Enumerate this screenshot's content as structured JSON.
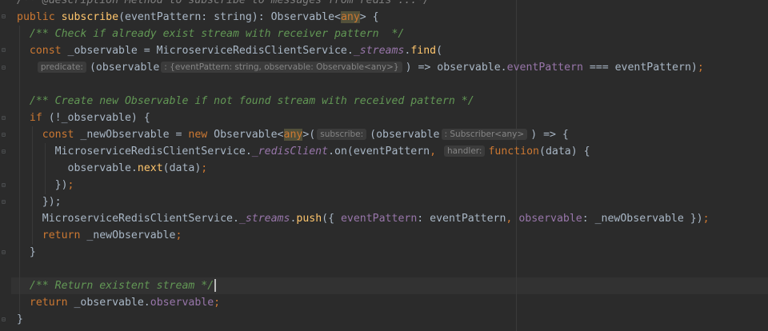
{
  "editor": {
    "lines": {
      "l0": "/** @description Method to subscribe to messages from redis ...*/",
      "l1_kw": "public",
      "l1_fn": "subscribe",
      "l1_a": "(eventPattern: string): Observable<",
      "l1_any": "any",
      "l1_b": "> {",
      "l2": "/** Check if already exist stream with receiver pattern  */",
      "l3_kw": "const",
      "l3_a": " _observable = MicroserviceRedisClientService.",
      "l3_sf": "_streams",
      "l3_b": ".",
      "l3_fn": "find",
      "l3_c": "(",
      "l4_hint1": "predicate:",
      "l4_a": "(observable",
      "l4_hint2": ": {eventPattern: string, observable: Observable<any>}",
      "l4_b": ") => observable.",
      "l4_pr": "eventPattern",
      "l4_c": " === eventPattern)",
      "l4_semi": ";",
      "l6": "/** Create new Observable if not found stream with received pattern */",
      "l7_kw": "if",
      "l7_a": " (!_observable) {",
      "l8_kw1": "const",
      "l8_a": " _newObservable = ",
      "l8_kw2": "new",
      "l8_b": " Observable<",
      "l8_any": "any",
      "l8_c": ">(",
      "l8_hint1": "subscribe:",
      "l8_d": "(observable",
      "l8_hint2": ": Subscriber<any>",
      "l8_e": ") => {",
      "l9_a": "MicroserviceRedisClientService.",
      "l9_sf": "_redisClient",
      "l9_b": ".on(eventPattern",
      "l9_comma": ",",
      "l9_hint": "handler:",
      "l9_kw": "function",
      "l9_c": "(data) {",
      "l10_a": "observable.",
      "l10_fn": "next",
      "l10_b": "(data)",
      "l10_semi": ";",
      "l11_a": "})",
      "l11_semi": ";",
      "l12": "});",
      "l13_a": "MicroserviceRedisClientService.",
      "l13_sf": "_streams",
      "l13_b": ".",
      "l13_fn": "push",
      "l13_c": "({ ",
      "l13_pr1": "eventPattern",
      "l13_d": ": eventPattern",
      "l13_comma": ",",
      "l13_pr2": "observable",
      "l13_e": ": _newObservable })",
      "l13_semi": ";",
      "l14_kw": "return",
      "l14_a": " _newObservable",
      "l14_semi": ";",
      "l15": "}",
      "l17": "/** Return existent stream */",
      "l18_kw": "return",
      "l18_a": " _observable.",
      "l18_pr": "observable",
      "l18_semi": ";",
      "l19": "}"
    }
  }
}
